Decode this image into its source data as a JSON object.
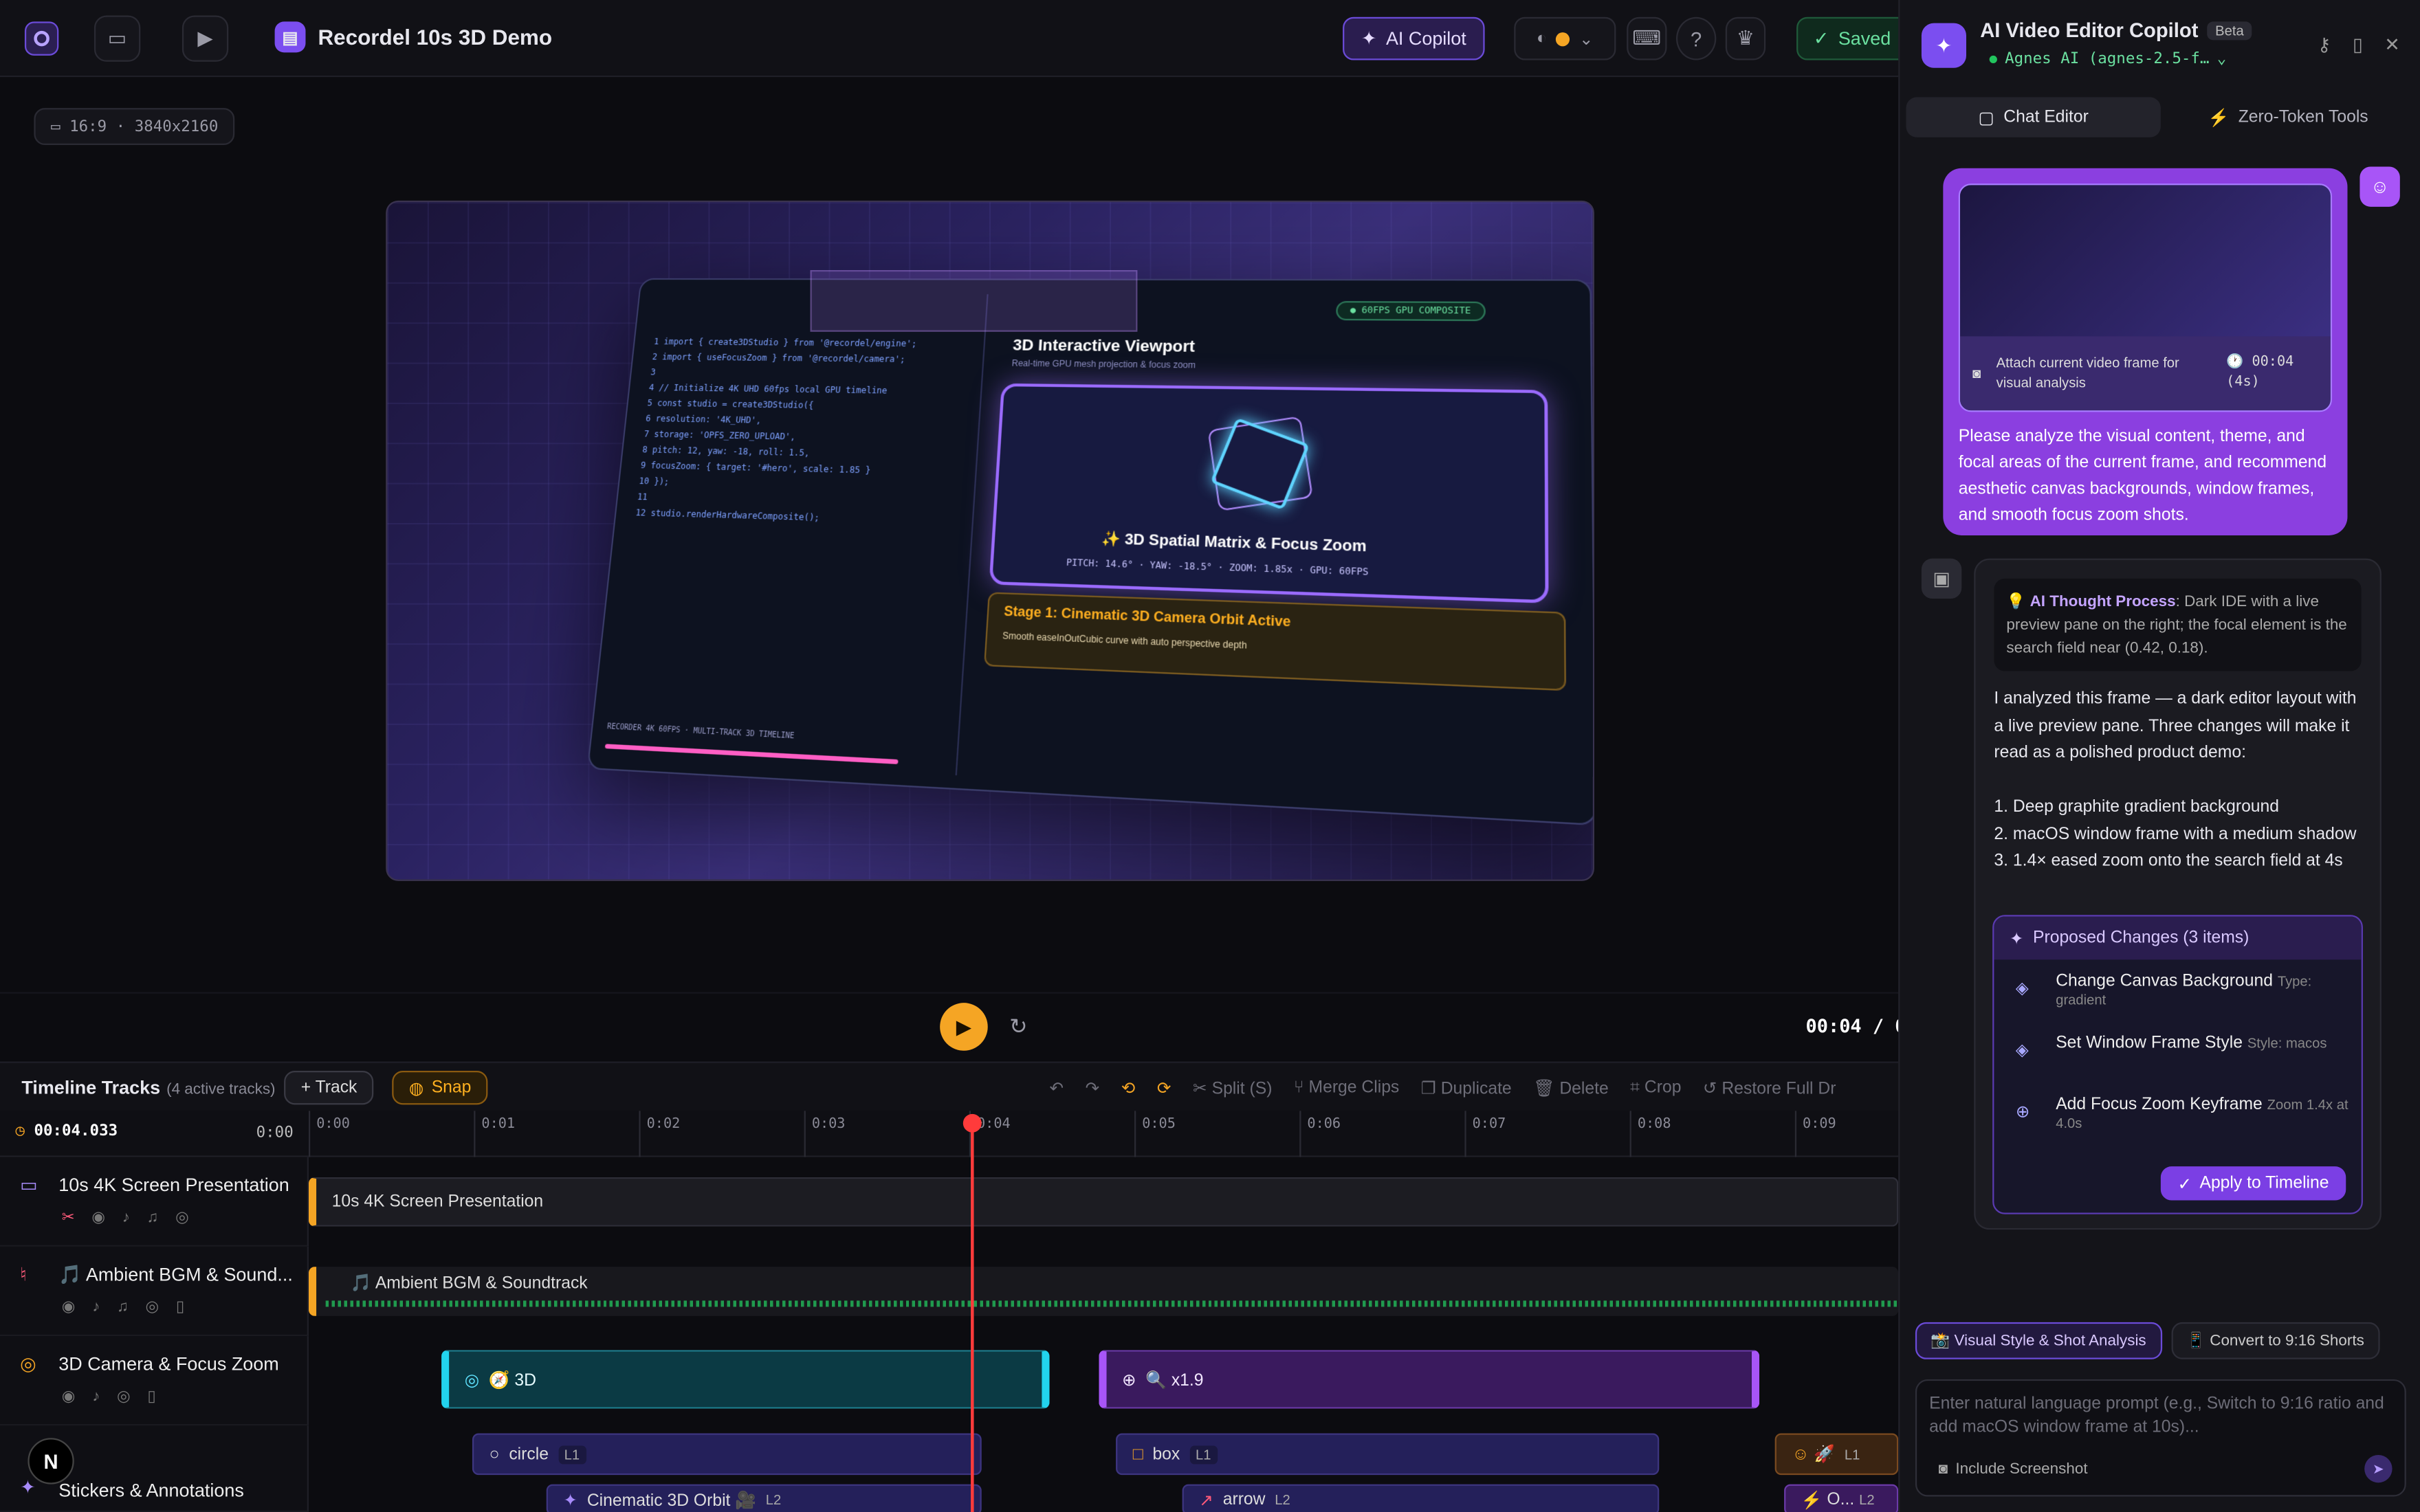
{
  "app": {
    "project_title": "Recordel 10s 3D Demo",
    "copilot_label": "AI Copilot",
    "saved_label": "Saved"
  },
  "stage": {
    "aspect_label": "16:9 · 3840x2160",
    "preview": {
      "code_lines": [
        "import { create3DStudio } from '@recordel/engine';",
        "import { useFocusZoom } from '@recordel/camera';",
        "",
        "// Initialize 4K UHD 60fps local GPU timeline",
        "const studio = create3DStudio({",
        "  resolution: '4K_UHD',",
        "  storage: 'OPFS_ZERO_UPLOAD',",
        "  pitch: 12, yaw: -18, roll: 1.5,",
        "  focusZoom: { target: '#hero', scale: 1.85 }",
        "});",
        "",
        "studio.renderHardwareComposite();"
      ],
      "viewport_title": "3D Interactive Viewport",
      "viewport_sub": "Real-time GPU mesh projection & focus zoom",
      "gpu_badge": "● 60FPS GPU COMPOSITE",
      "matrix_title": "✨ 3D Spatial Matrix & Focus Zoom",
      "matrix_meta": "PITCH: 14.6° · YAW: -18.5° · ZOOM: 1.85x · GPU: 60FPS",
      "stage_title": "Stage 1: Cinematic 3D Camera Orbit Active",
      "stage_sub": "Smooth easeInOutCubic curve with auto perspective depth",
      "timeline_caption": "RECORDER 4K 60FPS · MULTI-TRACK 3D TIMELINE"
    }
  },
  "playback": {
    "timecode": "00:04 / 0"
  },
  "timeline": {
    "title": "Timeline Tracks",
    "subtitle": "(4 active tracks)",
    "add_track": "+ Track",
    "snap": "Snap",
    "tools": [
      "Split (S)",
      "Merge Clips",
      "Duplicate",
      "Delete",
      "Crop",
      "Restore Full Dr"
    ],
    "current_time": "00:04.033",
    "start_time": "0:00",
    "ticks": [
      "0:00",
      "0:01",
      "0:02",
      "0:03",
      "0:04",
      "0:05",
      "0:06",
      "0:07",
      "0:08",
      "0:09"
    ],
    "tracks": [
      {
        "name": "10s 4K Screen Presentation"
      },
      {
        "name": "🎵 Ambient BGM & Sound..."
      },
      {
        "name": "3D Camera & Focus Zoom"
      },
      {
        "name": "Stickers & Annotations"
      }
    ],
    "clips": {
      "screen": "10s 4K Screen Presentation",
      "bgm": "🎵 Ambient BGM & Soundtrack",
      "cam_3d": "🧭 3D",
      "zoom": "🔍 x1.9",
      "circle": "circle",
      "circle_layer": "L1",
      "box": "box",
      "box_layer": "L1",
      "emoji_layer": "L1",
      "orbit": "Cinematic 3D Orbit 🎥",
      "orbit_layer": "L2",
      "arrow": "arrow",
      "arrow_layer": "L2",
      "emoji2": "O...",
      "emoji2_layer": "L2"
    }
  },
  "panel": {
    "title": "AI Video Editor Copilot",
    "beta": "Beta",
    "model": "Agnes AI (agnes-2.5-f…",
    "tabs": [
      "Chat Editor",
      "Zero-Token Tools"
    ],
    "user_message": {
      "attach_label": "Attach current video frame for visual analysis",
      "attach_time": "🕐 00:04 (4s)",
      "text": "Please analyze the visual content, theme, and focal areas of the current frame, and recommend aesthetic canvas backgrounds, window frames, and smooth focus zoom shots."
    },
    "bot_message": {
      "thought_label": "AI Thought Process",
      "thought_text": "Dark IDE with a live preview pane on the right; the focal element is the search field near (0.42, 0.18).",
      "text": "I analyzed this frame — a dark editor layout with a live preview pane. Three changes will make it read as a polished product demo:\n\n1. Deep graphite gradient background\n2. macOS window frame with a medium shadow\n3. 1.4× eased zoom onto the search field at 4s",
      "changes_title": "Proposed Changes (3 items)",
      "changes": [
        {
          "title": "Change Canvas Background",
          "meta": "Type: gradient"
        },
        {
          "title": "Set Window Frame Style",
          "meta": "Style: macos"
        },
        {
          "title": "Add Focus Zoom Keyframe",
          "meta": "Zoom 1.4x at 4.0s"
        }
      ],
      "apply_label": "Apply to Timeline"
    },
    "chips": [
      "📸 Visual Style & Shot Analysis",
      "📱 Convert to 9:16 Shorts"
    ],
    "prompt_placeholder": "Enter natural language prompt (e.g., Switch to 9:16 ratio and add macOS window frame at 10s)...",
    "include_screenshot": "Include Screenshot"
  },
  "colors": {
    "accent": "#7b4ef0",
    "playhead": "#ff3b3b",
    "play": "#f5a524",
    "saved": "#6be0a0"
  }
}
